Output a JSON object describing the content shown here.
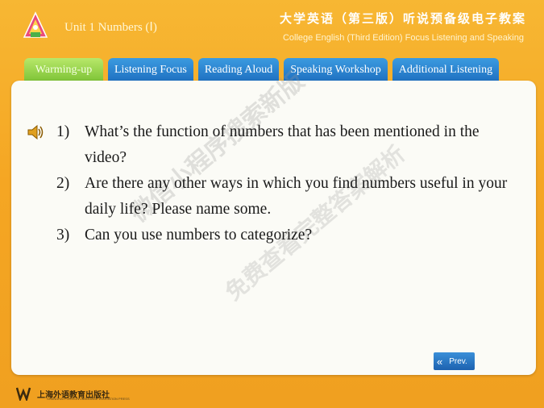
{
  "header": {
    "unit_title": "Unit 1  Numbers (Ⅰ)",
    "brand_cn": "大学英语（第三版）听说预备级电子教案",
    "brand_en": "College English (Third Edition) Focus Listening and Speaking"
  },
  "tabs": [
    {
      "label": "Warming-up",
      "active": true
    },
    {
      "label": "Listening Focus",
      "active": false
    },
    {
      "label": "Reading Aloud",
      "active": false
    },
    {
      "label": "Speaking Workshop",
      "active": false
    },
    {
      "label": "Additional Listening",
      "active": false
    }
  ],
  "questions": [
    {
      "num": "1)",
      "text": "What’s the function of numbers that has been mentioned in the video?"
    },
    {
      "num": "2)",
      "text": "Are there any other ways in which you find numbers useful in your daily life? Please name some."
    },
    {
      "num": "3)",
      "text": "Can you use numbers to categorize?"
    }
  ],
  "nav": {
    "prev_label": "Prev.",
    "prev_icon": "double-chevron-left-icon"
  },
  "watermark": {
    "line1": "微信小程序搜索新版",
    "line2": "免费查看完整答案解析"
  },
  "publisher": {
    "name": "上海外语教育出版社",
    "sub": "SHANGHAI FOREIGN LANGUAGE EDUCATION PRESS"
  },
  "icons": {
    "speaker": "speaker-icon",
    "logo": "book-logo-icon"
  },
  "colors": {
    "tab_blue": "#1e6fc0",
    "tab_active": "#7cc235",
    "background": "#f5a623",
    "panel": "#fbfbf6"
  }
}
